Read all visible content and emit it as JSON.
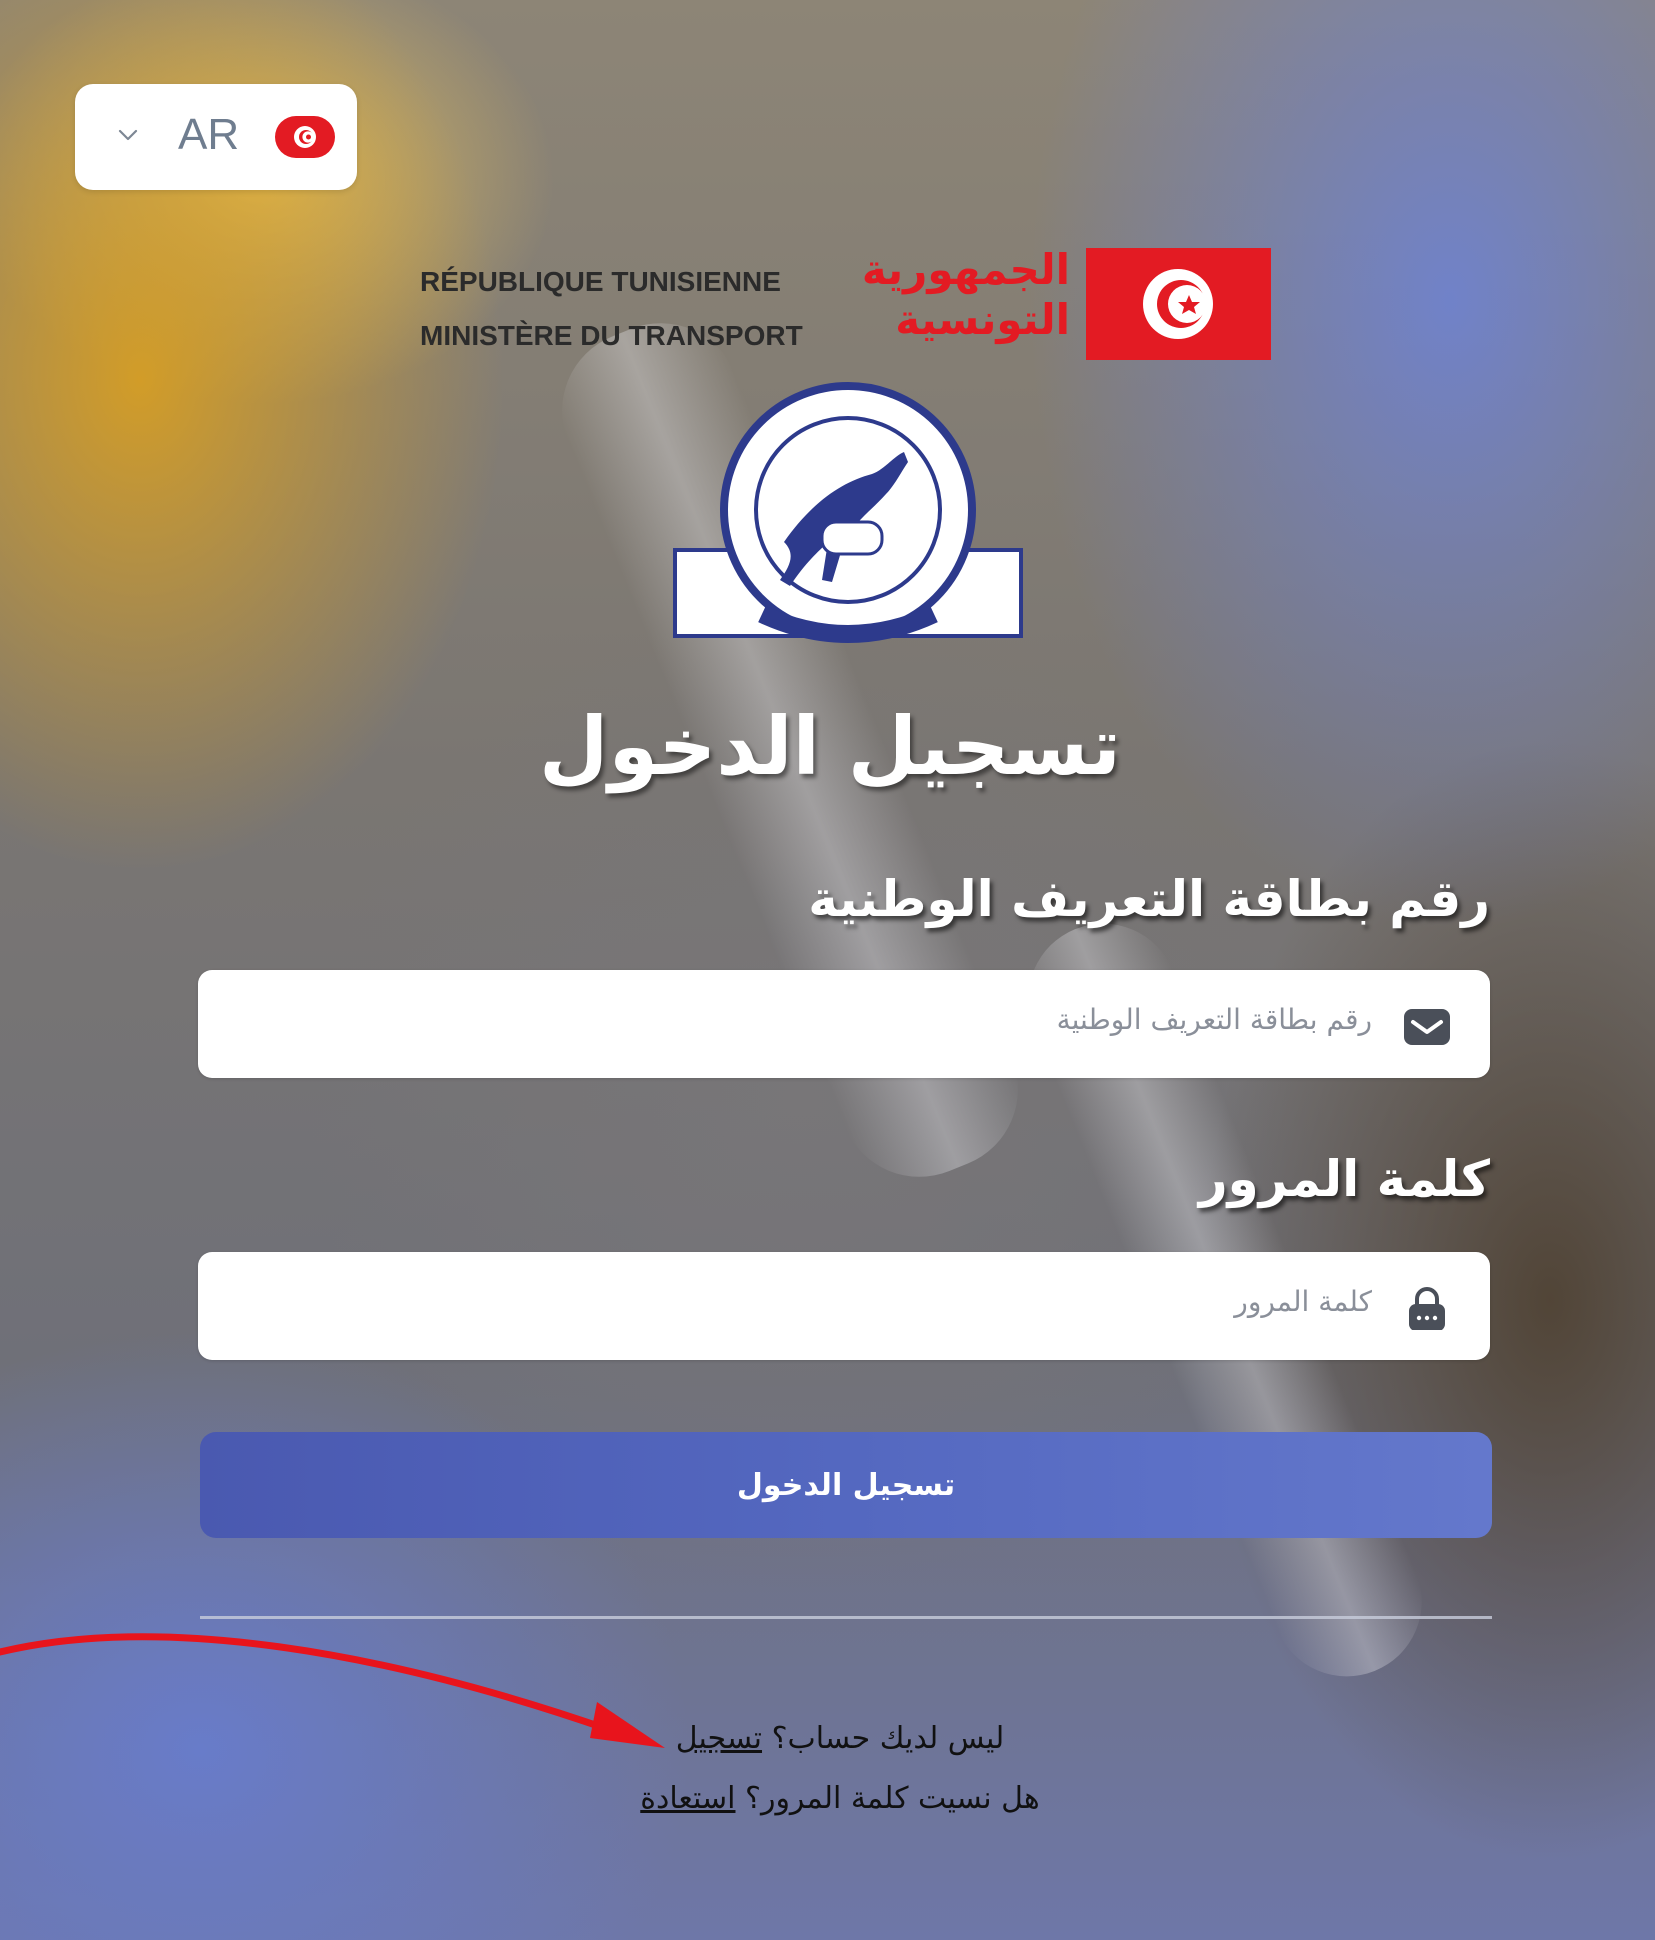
{
  "language": {
    "code": "AR"
  },
  "header": {
    "fr_line1": "RÉPUBLIQUE TUNISIENNE",
    "fr_line2": "MINISTÈRE DU TRANSPORT",
    "ar_line1": "الجمهورية",
    "ar_line2": "التونسية"
  },
  "login": {
    "title": "تسجيل الدخول",
    "id_label": "رقم بطاقة التعريف الوطنية",
    "id_placeholder": "رقم بطاقة التعريف الوطنية",
    "password_label": "كلمة المرور",
    "password_placeholder": "كلمة المرور",
    "submit_label": "تسجيل الدخول"
  },
  "footer": {
    "register_prompt": "ليس لديك حساب؟",
    "register_link": "تسجيل",
    "forgot_prompt": "هل نسيت كلمة المرور؟",
    "forgot_link": "استعادة"
  },
  "colors": {
    "accent": "#5468c0",
    "brand_red": "#e31b23",
    "annotation_arrow": "#e8141c"
  },
  "icons": {
    "id_field": "envelope-icon",
    "password_field": "lock-icon",
    "language_toggle": "chevron-down-icon"
  }
}
